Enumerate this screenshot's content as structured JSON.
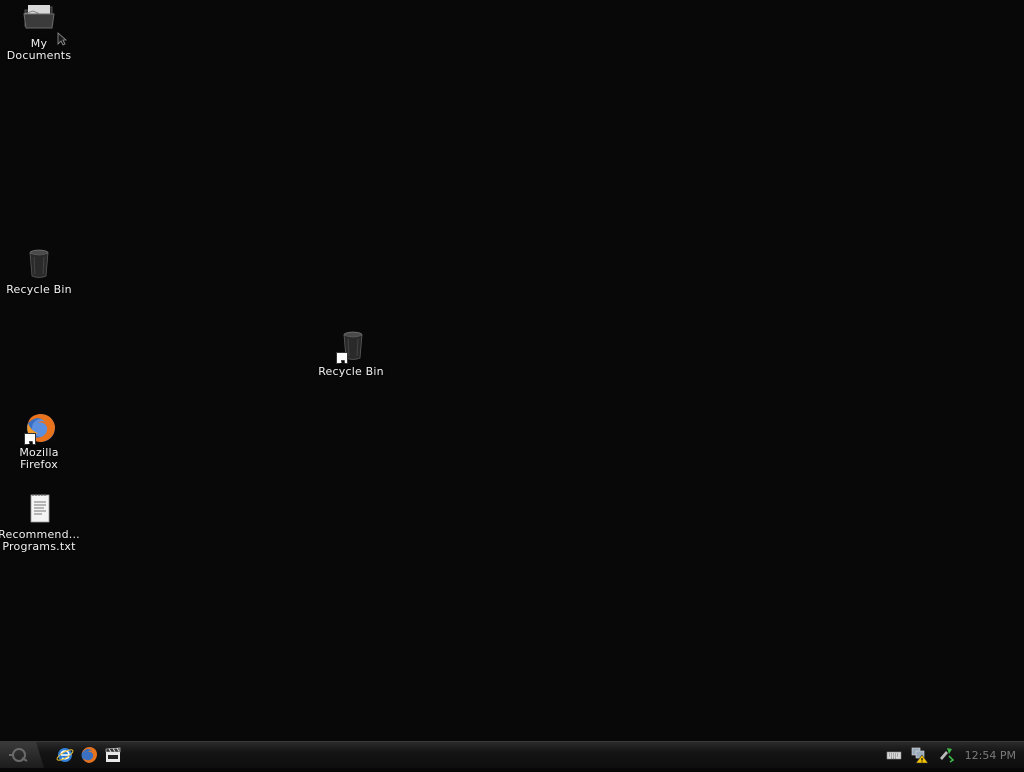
{
  "desktop": {
    "icons": [
      {
        "id": "my-documents",
        "label": "My\nDocuments",
        "icon": "folder-icon",
        "shortcut": false
      },
      {
        "id": "recycle-bin",
        "label": "Recycle Bin",
        "icon": "recycle-bin-icon",
        "shortcut": false
      },
      {
        "id": "recycle-bin-shortcut",
        "label": "Recycle Bin",
        "icon": "recycle-bin-icon",
        "shortcut": true
      },
      {
        "id": "mozilla-firefox",
        "label": "Mozilla\nFirefox",
        "icon": "firefox-icon",
        "shortcut": true
      },
      {
        "id": "recommended-programs",
        "label": "Recommend...\nPrograms.txt",
        "icon": "text-document-icon",
        "shortcut": false
      }
    ]
  },
  "taskbar": {
    "start_icon": "start-orb-icon",
    "quick_launch": [
      {
        "name": "internet-explorer-icon"
      },
      {
        "name": "firefox-icon"
      },
      {
        "name": "media-player-icon"
      }
    ],
    "tray": [
      {
        "name": "keyboard-icon"
      },
      {
        "name": "network-warning-icon"
      },
      {
        "name": "safely-remove-hardware-icon"
      }
    ],
    "clock": "12:54 PM"
  },
  "colors": {
    "desktop_background": "#080808",
    "label_text": "#f2f2f2",
    "firefox_orange": "#e8731c",
    "firefox_blue": "#3a6fc2"
  }
}
